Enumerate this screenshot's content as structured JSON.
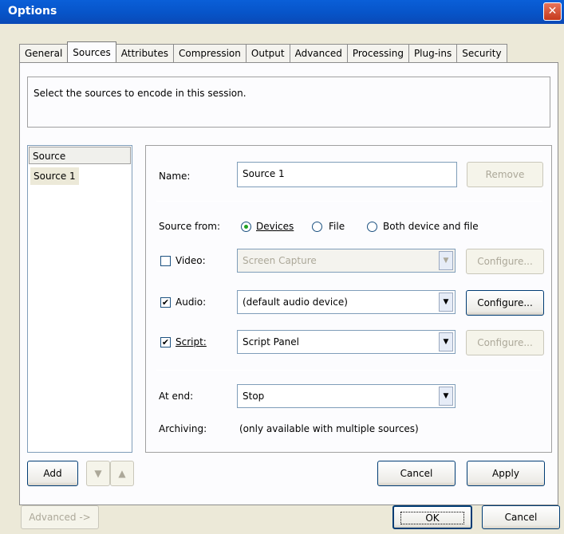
{
  "window": {
    "title": "Options",
    "close_glyph": "✕"
  },
  "tabs": [
    "General",
    "Sources",
    "Attributes",
    "Compression",
    "Output",
    "Advanced",
    "Processing",
    "Plug-ins",
    "Security"
  ],
  "active_tab": "Sources",
  "description": "Select the sources to encode in this session.",
  "source_list": {
    "header": "Source",
    "items": [
      "Source 1"
    ],
    "selected": "Source 1"
  },
  "list_buttons": {
    "add": "Add",
    "move_down": "▼",
    "move_up": "▲"
  },
  "name": {
    "label": "Name:",
    "value": "Source 1",
    "remove": "Remove"
  },
  "source_from": {
    "label": "Source from:",
    "options": [
      "Devices",
      "File",
      "Both device and file"
    ],
    "selected": "Devices"
  },
  "devices": {
    "video": {
      "label": "Video:",
      "checked": false,
      "value": "Screen Capture",
      "configure": "Configure...",
      "enabled": false
    },
    "audio": {
      "label": "Audio:",
      "checked": true,
      "value": "(default audio device)",
      "configure": "Configure...",
      "enabled": true
    },
    "script": {
      "label": "Script:",
      "checked": true,
      "value": "Script Panel",
      "configure": "Configure...",
      "enabled": false
    }
  },
  "at_end": {
    "label": "At end:",
    "value": "Stop"
  },
  "archiving": {
    "label": "Archiving:",
    "value": "(only available with multiple sources)"
  },
  "panel_buttons": {
    "cancel": "Cancel",
    "apply": "Apply"
  },
  "footer": {
    "advanced": "Advanced ->",
    "ok": "OK",
    "cancel": "Cancel"
  },
  "colors": {
    "titlebar": "#0754c8",
    "dialog_bg": "#ece9d8",
    "radio_dot": "#21a121"
  }
}
